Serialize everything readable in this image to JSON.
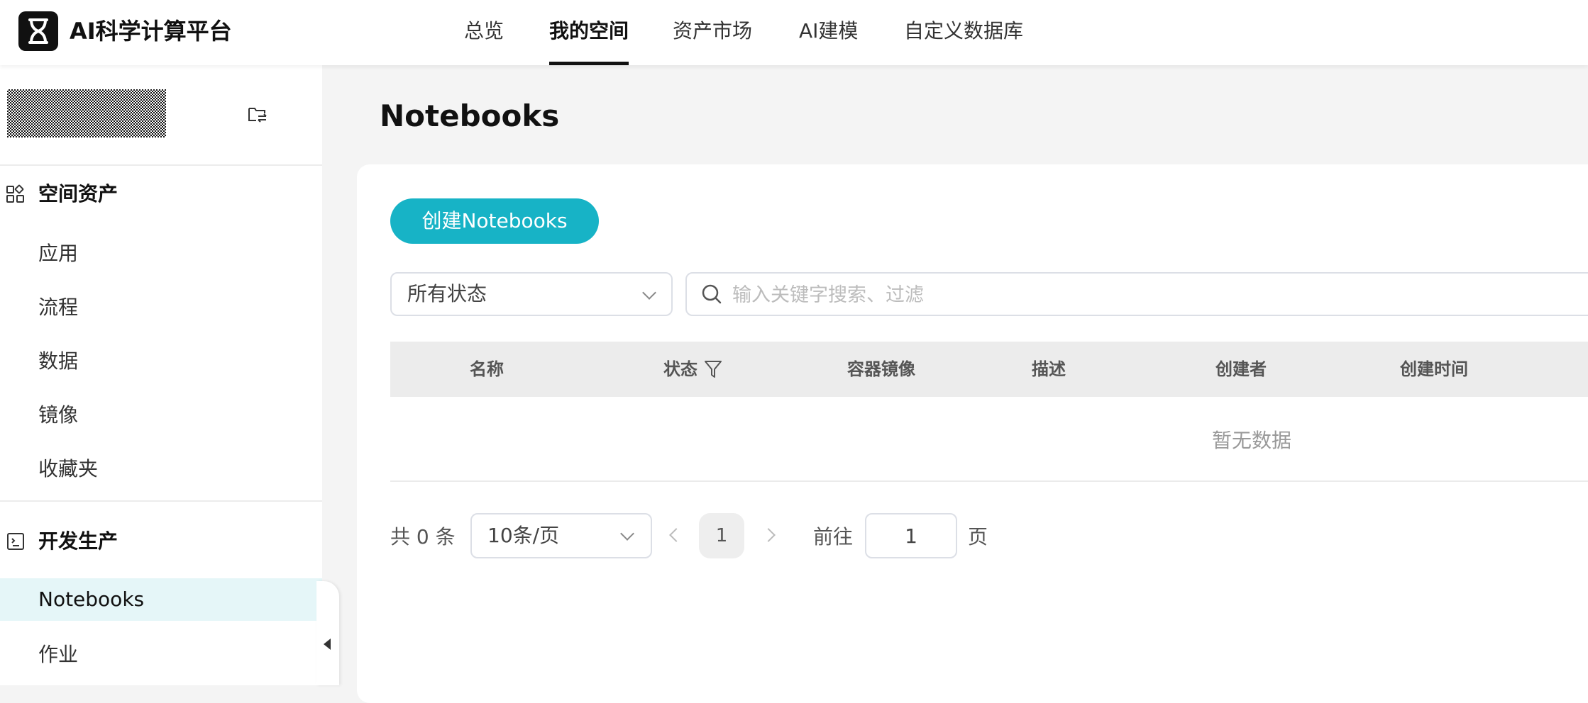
{
  "app": {
    "title": "AI科学计算平台"
  },
  "nav": {
    "items": [
      "总览",
      "我的空间",
      "资产市场",
      "AI建模",
      "自定义数据库"
    ],
    "active": "我的空间"
  },
  "sidebar": {
    "groups": [
      {
        "label": "空间资产",
        "icon": "grid-icon",
        "items": [
          "应用",
          "流程",
          "数据",
          "镜像",
          "收藏夹"
        ]
      },
      {
        "label": "开发生产",
        "icon": "terminal-icon",
        "items": [
          "Notebooks",
          "作业"
        ]
      }
    ],
    "active_item": "Notebooks"
  },
  "main": {
    "title": "Notebooks",
    "create_button": "创建Notebooks",
    "status_filter": "所有状态",
    "search_placeholder": "输入关键字搜索、过滤",
    "columns": [
      "名称",
      "状态",
      "容器镜像",
      "描述",
      "创建者",
      "创建时间"
    ],
    "empty_text": "暂无数据"
  },
  "pagination": {
    "total": "共 0 条",
    "page_size": "10条/页",
    "current_page": "1",
    "goto_label": "前往",
    "goto_value": "1",
    "page_suffix": "页"
  },
  "colors": {
    "accent": "#17b3c6",
    "active_bg": "#e5f6f8"
  }
}
